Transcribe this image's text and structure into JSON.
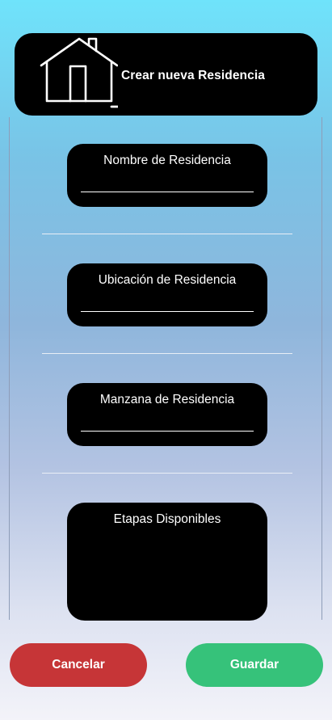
{
  "header": {
    "title": "Crear nueva Residencia",
    "icon": "house-add-icon"
  },
  "form": {
    "fields": [
      {
        "label": "Nombre de Residencia",
        "value": ""
      },
      {
        "label": "Ubicación de Residencia",
        "value": ""
      },
      {
        "label": "Manzana de Residencia",
        "value": ""
      }
    ],
    "stages": {
      "label": "Etapas Disponibles"
    }
  },
  "buttons": {
    "cancel_label": "Cancelar",
    "save_label": "Guardar"
  },
  "colors": {
    "cancel": "#c63537",
    "save": "#36c27a",
    "card": "#000000"
  }
}
